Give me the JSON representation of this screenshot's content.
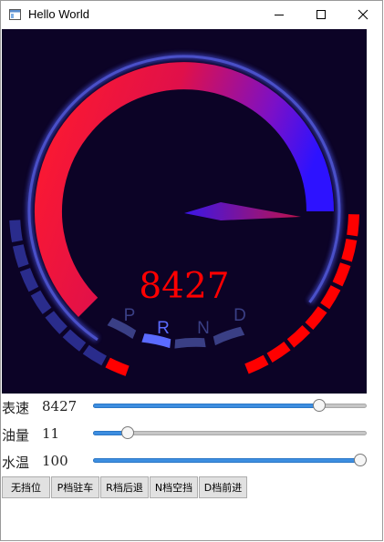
{
  "window": {
    "title": "Hello World",
    "icon": "app-window-icon",
    "controls": [
      "minimize-icon",
      "maximize-icon",
      "close-icon"
    ]
  },
  "gauge": {
    "speed_text": "8427",
    "gears": [
      "P",
      "R",
      "N",
      "D"
    ],
    "active_gear": "R",
    "meter_fraction": 0.843,
    "fuel_fraction": 0.11,
    "temp_fraction": 1.0,
    "colors": {
      "background": "#0c0326",
      "arc_red": "#ff1a2e",
      "arc_blue": "#2d12ff",
      "segment_dim": "#2a2c8c",
      "segment_red": "#ff0000",
      "gear_active": "#5b6bff",
      "gear_dim": "#3a3f85",
      "speed_text": "#ff0000",
      "needle_start": "#3a16e8",
      "needle_end": "#c0124a"
    }
  },
  "controls": {
    "speed": {
      "label": "表速",
      "value": "8427",
      "fraction": 0.843
    },
    "fuel": {
      "label": "油量",
      "value": "11",
      "fraction": 0.11
    },
    "temp": {
      "label": "水温",
      "value": "100",
      "fraction": 1.0
    }
  },
  "buttons": {
    "no_gear": "无挡位",
    "p_gear": "P档驻车",
    "r_gear": "R档后退",
    "n_gear": "N档空挡",
    "d_gear": "D档前进"
  }
}
